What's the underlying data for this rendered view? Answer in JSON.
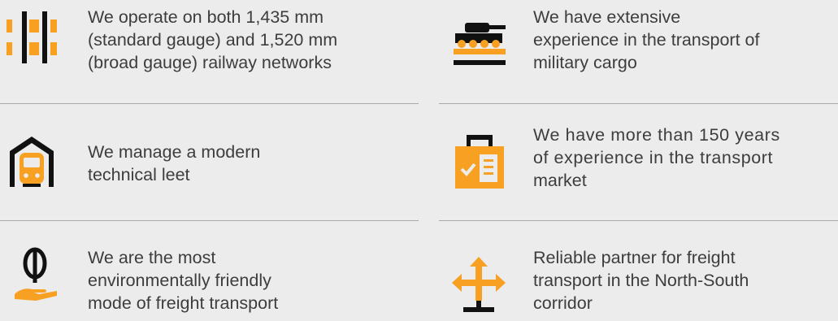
{
  "colors": {
    "accent": "#f7a021",
    "dark": "#111111",
    "text": "#3d3d3d",
    "background": "#ececec",
    "divider": "#a9a9a9"
  },
  "features": [
    {
      "icon": "rail-track-icon",
      "lines": [
        "We operate on both 1,435 mm",
        "(standard gauge) and 1,520 mm",
        "(broad gauge) railway networks"
      ]
    },
    {
      "icon": "tank-on-wagon-icon",
      "lines": [
        "We have extensive",
        "experience in the transport of",
        "military cargo"
      ]
    },
    {
      "icon": "train-depot-icon",
      "lines": [
        "We manage a modern",
        "technical leet"
      ]
    },
    {
      "icon": "clipboard-check-icon",
      "lines": [
        "We have more than 150 years",
        "of experience in the transport",
        "market"
      ]
    },
    {
      "icon": "leaf-on-hand-icon",
      "lines": [
        "We are the most",
        "environmentally friendly",
        "mode of freight transport"
      ]
    },
    {
      "icon": "directions-arrows-icon",
      "lines": [
        "Reliable partner for freight",
        "transport in the North-South",
        "corridor"
      ]
    }
  ]
}
